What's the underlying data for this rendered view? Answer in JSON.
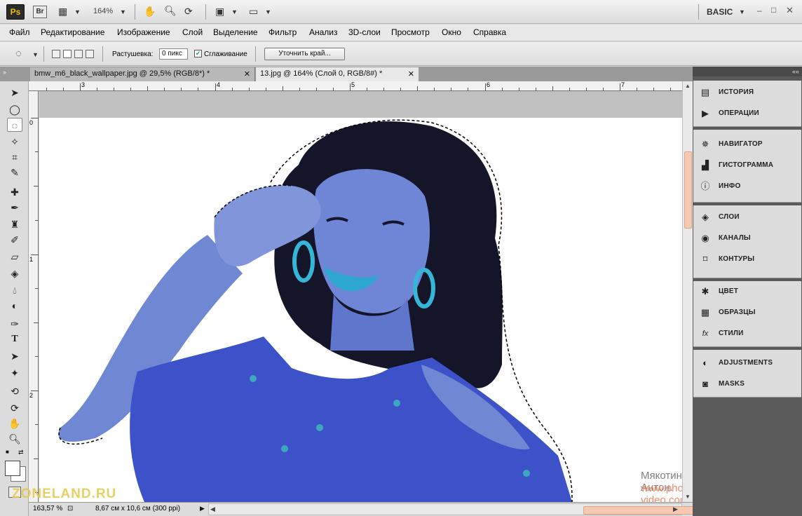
{
  "app": {
    "logo": "Ps",
    "bridge": "Br",
    "zoom": "164%",
    "workspace": "BASIC",
    "icons": [
      "launch-bridge-icon",
      "screen-mode-icon",
      "hand-icon",
      "zoom-icon",
      "rotate-view-icon",
      "arrange-documents-icon",
      "screen-mode-icon"
    ]
  },
  "menu": [
    "Файл",
    "Редактирование",
    "Изображение",
    "Слой",
    "Выделение",
    "Фильтр",
    "Анализ",
    "3D-слои",
    "Просмотр",
    "Окно",
    "Справка"
  ],
  "options": {
    "feather_label": "Растушевка:",
    "feather_value": "0 пикс",
    "antialias_label": "Сглаживание",
    "antialias_checked": true,
    "refine_button": "Уточнить край..."
  },
  "tabs": [
    {
      "title": "bmw_m6_black_wallpaper.jpg @ 29,5% (RGB/8*) *",
      "active": false
    },
    {
      "title": "13.jpg @ 164% (Слой 0, RGB/8#) *",
      "active": true
    }
  ],
  "ruler": {
    "h": [
      "3",
      "4",
      "5",
      "6",
      "7"
    ],
    "v": [
      "0",
      "1",
      "2"
    ]
  },
  "status": {
    "zoom": "163,57 %",
    "doc_size": "8,67 см x 10,6 см (300 ppi)"
  },
  "panels": [
    {
      "items": [
        {
          "label": "ИСТОРИЯ",
          "icon": "history-icon"
        },
        {
          "label": "ОПЕРАЦИИ",
          "icon": "actions-icon"
        }
      ]
    },
    {
      "items": [
        {
          "label": "НАВИГАТОР",
          "icon": "navigator-icon"
        },
        {
          "label": "ГИСТОГРАММА",
          "icon": "histogram-icon"
        },
        {
          "label": "ИНФО",
          "icon": "info-icon"
        }
      ]
    },
    {
      "items": [
        {
          "label": "СЛОИ",
          "icon": "layers-icon"
        },
        {
          "label": "КАНАЛЫ",
          "icon": "channels-icon"
        },
        {
          "label": "КОНТУРЫ",
          "icon": "paths-icon"
        }
      ]
    },
    {
      "items": [
        {
          "label": "ЦВЕТ",
          "icon": "color-icon"
        },
        {
          "label": "ОБРАЗЦЫ",
          "icon": "swatches-icon"
        },
        {
          "label": "СТИЛИ",
          "icon": "styles-icon"
        }
      ]
    },
    {
      "items": [
        {
          "label": "ADJUSTMENTS",
          "icon": "adjustments-icon"
        },
        {
          "label": "MASKS",
          "icon": "masks-icon"
        }
      ]
    }
  ],
  "watermark": {
    "author": "Мякотин Антон.",
    "site": "www.photoshop-video.com",
    "logo": "ZONELAND.RU"
  },
  "colors": {
    "photo_blue": "#3d52c9",
    "skin_blue": "#6f86d6",
    "accent_cyan": "#35b6d6",
    "hair": "#15152a"
  }
}
